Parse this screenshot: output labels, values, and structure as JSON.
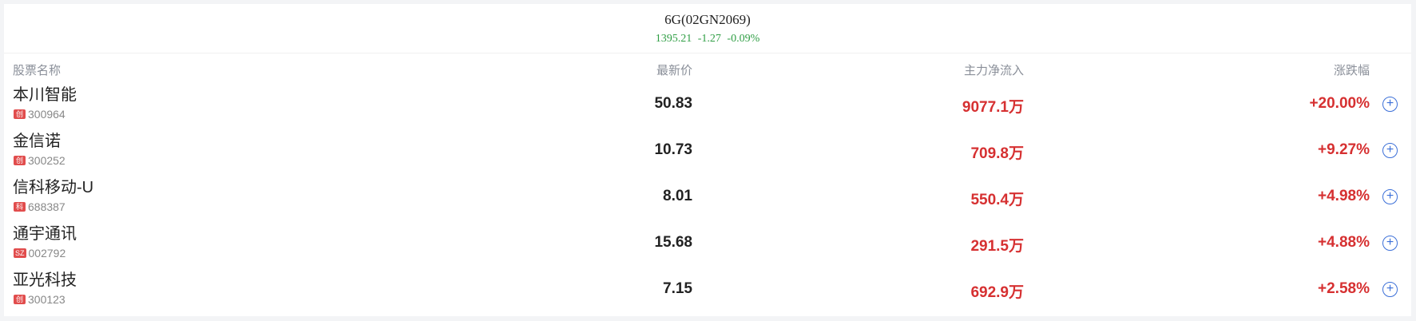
{
  "header": {
    "title": "6G(02GN2069)",
    "price": "1395.21",
    "change": "-1.27",
    "change_pct": "-0.09%"
  },
  "columns": {
    "name": "股票名称",
    "price": "最新价",
    "flow": "主力净流入",
    "change": "涨跌幅"
  },
  "rows": [
    {
      "name": "本川智能",
      "badge": "创",
      "code": "300964",
      "price": "50.83",
      "flow": "9077.1万",
      "change": "+20.00%"
    },
    {
      "name": "金信诺",
      "badge": "创",
      "code": "300252",
      "price": "10.73",
      "flow": "709.8万",
      "change": "+9.27%"
    },
    {
      "name": "信科移动-U",
      "badge": "科",
      "code": "688387",
      "price": "8.01",
      "flow": "550.4万",
      "change": "+4.98%"
    },
    {
      "name": "通宇通讯",
      "badge": "SZ",
      "code": "002792",
      "price": "15.68",
      "flow": "291.5万",
      "change": "+4.88%"
    },
    {
      "name": "亚光科技",
      "badge": "创",
      "code": "300123",
      "price": "7.15",
      "flow": "692.9万",
      "change": "+2.58%"
    }
  ],
  "add_icon_glyph": "+",
  "colors": {
    "up": "#d63031",
    "down": "#2f9e44",
    "accent": "#3b6fd8"
  }
}
